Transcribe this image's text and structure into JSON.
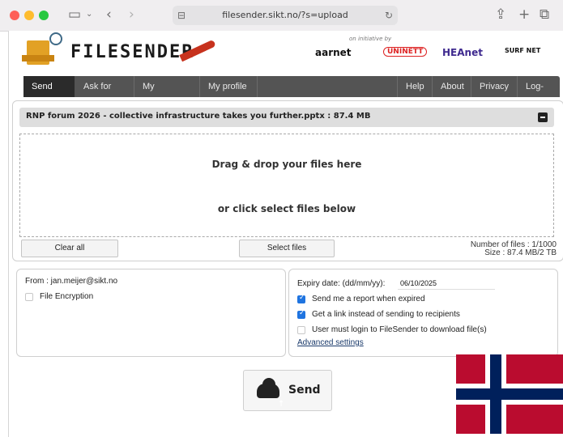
{
  "browser": {
    "url": "filesender.sikt.no/?s=upload"
  },
  "header": {
    "logo_text": "FILESENDER",
    "initiative_text": "on initiative by",
    "partners": [
      "aarnet",
      "UNINETT",
      "HEAnet",
      "SURF NET"
    ]
  },
  "nav": {
    "left": [
      "Send files",
      "Ask for files",
      "My Transfers",
      "My profile"
    ],
    "right": [
      "Help",
      "About",
      "Privacy",
      "Log-off"
    ],
    "active": "Send files"
  },
  "upload": {
    "file_entry": "RNP forum 2026 - collective infrastructure takes you further.pptx : 87.4 MB",
    "drag_text": "Drag & drop your files here",
    "click_text": "or click select files below",
    "clear_all": "Clear all",
    "select_files": "Select files",
    "number_of_files": "Number of files : 1/1000",
    "size": "Size : 87.4 MB/2 TB"
  },
  "from": {
    "label": "From : jan.meijer@sikt.no",
    "file_encryption": "File Encryption",
    "file_encryption_checked": false
  },
  "options": {
    "expiry_label": "Expiry date: (dd/mm/yy):",
    "expiry_value": "06/10/2025",
    "checkboxes": [
      {
        "label": "Send me a report when expired",
        "checked": true
      },
      {
        "label": "Get a link instead of sending to recipients",
        "checked": true
      },
      {
        "label": "User must login to FileSender to download file(s)",
        "checked": false
      }
    ],
    "advanced": "Advanced settings"
  },
  "send_label": "Send",
  "colors": {
    "nav_bg": "#545454",
    "nav_active": "#2b2b2b",
    "checkbox_blue": "#1f74e0",
    "flag_red": "#ba0c2f",
    "flag_blue": "#00205b"
  }
}
